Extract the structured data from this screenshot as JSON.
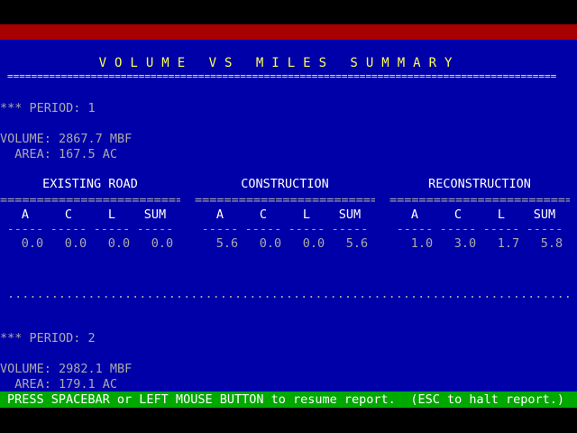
{
  "header": {
    "title": "VOLUME VS MILES SUMMARY",
    "divider": "============================================================================================"
  },
  "period1": {
    "label": "*** PERIOD: 1",
    "volume": "VOLUME: 2867.7 MBF",
    "area": "  AREA: 167.5 AC"
  },
  "groups": [
    {
      "title": "EXISTING ROAD",
      "rule": "==========================",
      "cols": [
        "A",
        "C",
        "L",
        "SUM"
      ],
      "dashes": [
        "-----",
        "-----",
        "-----",
        "-----"
      ],
      "values": [
        "0.0",
        "0.0",
        "0.0",
        "0.0"
      ]
    },
    {
      "title": "CONSTRUCTION",
      "rule": "==========================",
      "cols": [
        "A",
        "C",
        "L",
        "SUM"
      ],
      "dashes": [
        "-----",
        "-----",
        "-----",
        "-----"
      ],
      "values": [
        "5.6",
        "0.0",
        "0.0",
        "5.6"
      ]
    },
    {
      "title": "RECONSTRUCTION",
      "rule": "==========================",
      "cols": [
        "A",
        "C",
        "L",
        "SUM"
      ],
      "dashes": [
        "-----",
        "-----",
        "-----",
        "-----"
      ],
      "values": [
        "1.0",
        "3.0",
        "1.7",
        "5.8"
      ]
    }
  ],
  "separator": "...............................................................................",
  "period2": {
    "label": "*** PERIOD: 2",
    "volume": "VOLUME: 2982.1 MBF",
    "area": "  AREA: 179.1 AC"
  },
  "statusbar": {
    "left": "PRESS SPACEBAR or LEFT MOUSE BUTTON to resume report.",
    "right": "(ESC to halt report.)"
  }
}
